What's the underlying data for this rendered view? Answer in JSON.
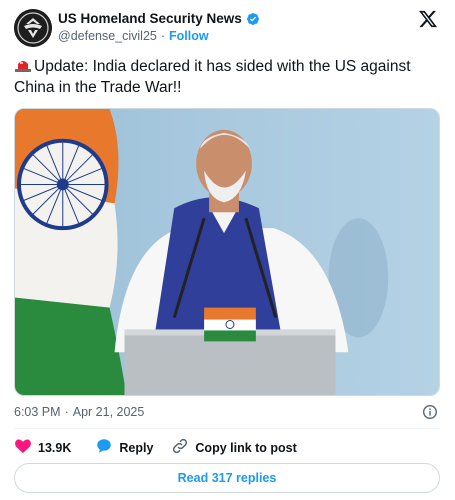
{
  "author": {
    "display_name": "US Homeland Security News",
    "handle": "@defense_civil25",
    "separator": "·",
    "follow_label": "Follow",
    "verified": true
  },
  "tweet": {
    "text": "Update: India declared it has sided with the US against China in the Trade War!!",
    "leading_emoji": "rotating-light-icon"
  },
  "meta": {
    "time": "6:03 PM",
    "separator": "·",
    "date": "Apr 21, 2025"
  },
  "actions": {
    "likes": "13.9K",
    "reply_label": "Reply",
    "copy_label": "Copy link to post"
  },
  "read_replies_label": "Read 317 replies",
  "colors": {
    "accent": "#1d9bf0",
    "like": "#f91880",
    "text": "#0f1419",
    "muted": "#536471"
  }
}
